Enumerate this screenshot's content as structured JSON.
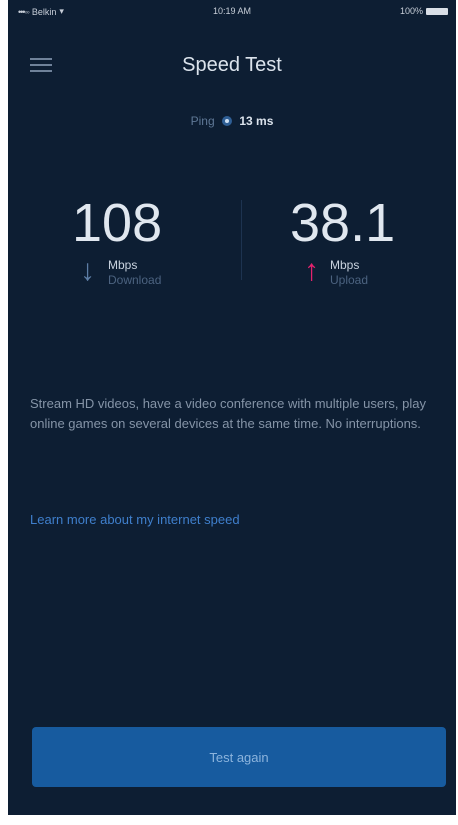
{
  "status_bar": {
    "carrier": "Belkin",
    "time": "10:19 AM",
    "battery": "100%"
  },
  "header": {
    "title": "Speed Test"
  },
  "ping": {
    "label": "Ping",
    "value": "13 ms"
  },
  "download": {
    "value": "108",
    "unit": "Mbps",
    "label": "Download"
  },
  "upload": {
    "value": "38.1",
    "unit": "Mbps",
    "label": "Upload"
  },
  "description": "Stream HD videos, have a video conference with multiple users, play online games on several devices at the same time. No interruptions.",
  "learn_more_link": "Learn more about my internet speed",
  "test_again_button": "Test again",
  "colors": {
    "background": "#0d1e33",
    "accent": "#175b9f",
    "upload_arrow": "#e4226e",
    "download_arrow": "#5d7ea6",
    "link": "#3f7fcc"
  },
  "icons": {
    "menu": "hamburger-menu-icon",
    "download": "arrow-down-icon",
    "upload": "arrow-up-icon",
    "ping": "ping-dot-icon"
  }
}
